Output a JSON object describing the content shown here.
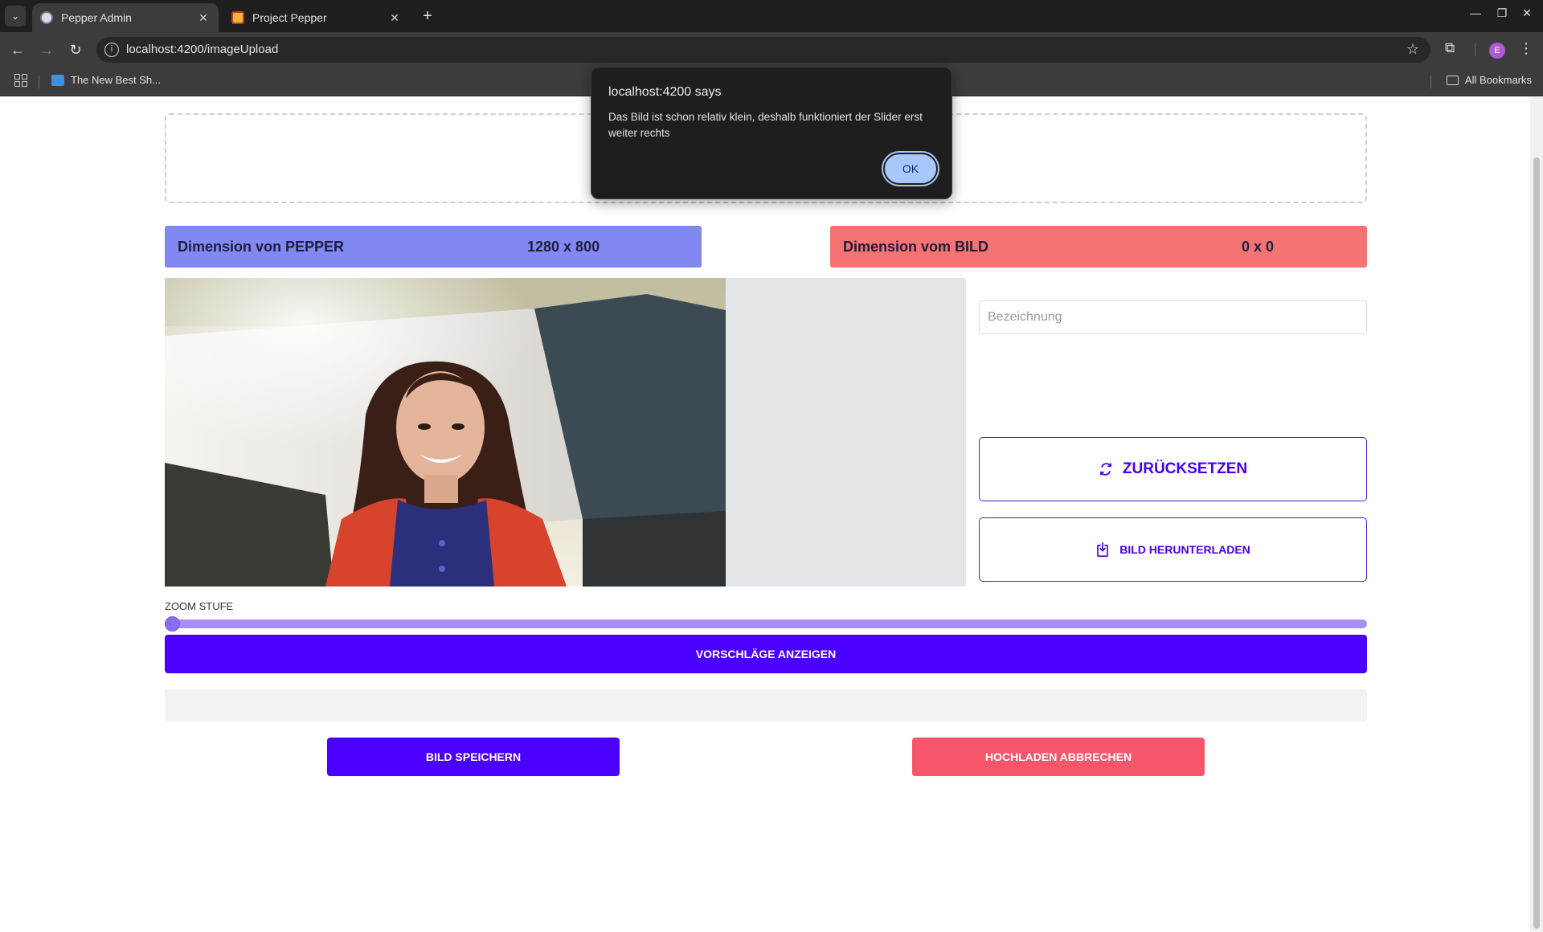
{
  "browser": {
    "tabs": [
      {
        "title": "Pepper Admin",
        "active": true
      },
      {
        "title": "Project Pepper",
        "active": false
      }
    ],
    "url": "localhost:4200/imageUpload",
    "bookmarks": [
      {
        "label": "The New Best Sh..."
      }
    ],
    "all_bookmarks_label": "All Bookmarks",
    "profile_initial": "E"
  },
  "dimensions": {
    "pepper": {
      "label": "Dimension von PEPPER",
      "value": "1280 x 800",
      "color": "#8288f2"
    },
    "bild": {
      "label": "Dimension vom BILD",
      "value": "0 x 0",
      "color": "#f47373"
    }
  },
  "form": {
    "name_placeholder": "Bezeichnung",
    "name_value": ""
  },
  "buttons": {
    "reset": "ZURÜCKSETZEN",
    "download": "BILD HERUNTERLADEN",
    "suggestions": "VORSCHLÄGE ANZEIGEN",
    "save": "BILD SPEICHERN",
    "cancel": "HOCHLADEN ABBRECHEN"
  },
  "zoom": {
    "label": "ZOOM STUFE",
    "value_fraction": 0.0
  },
  "dialog": {
    "title": "localhost:4200 says",
    "message": "Das Bild ist schon relativ klein, deshalb funktioniert der Slider erst weiter rechts",
    "ok": "OK"
  },
  "colors": {
    "primary": "#4a00ff",
    "danger": "#f7566a",
    "slider": "#a88ff5"
  }
}
